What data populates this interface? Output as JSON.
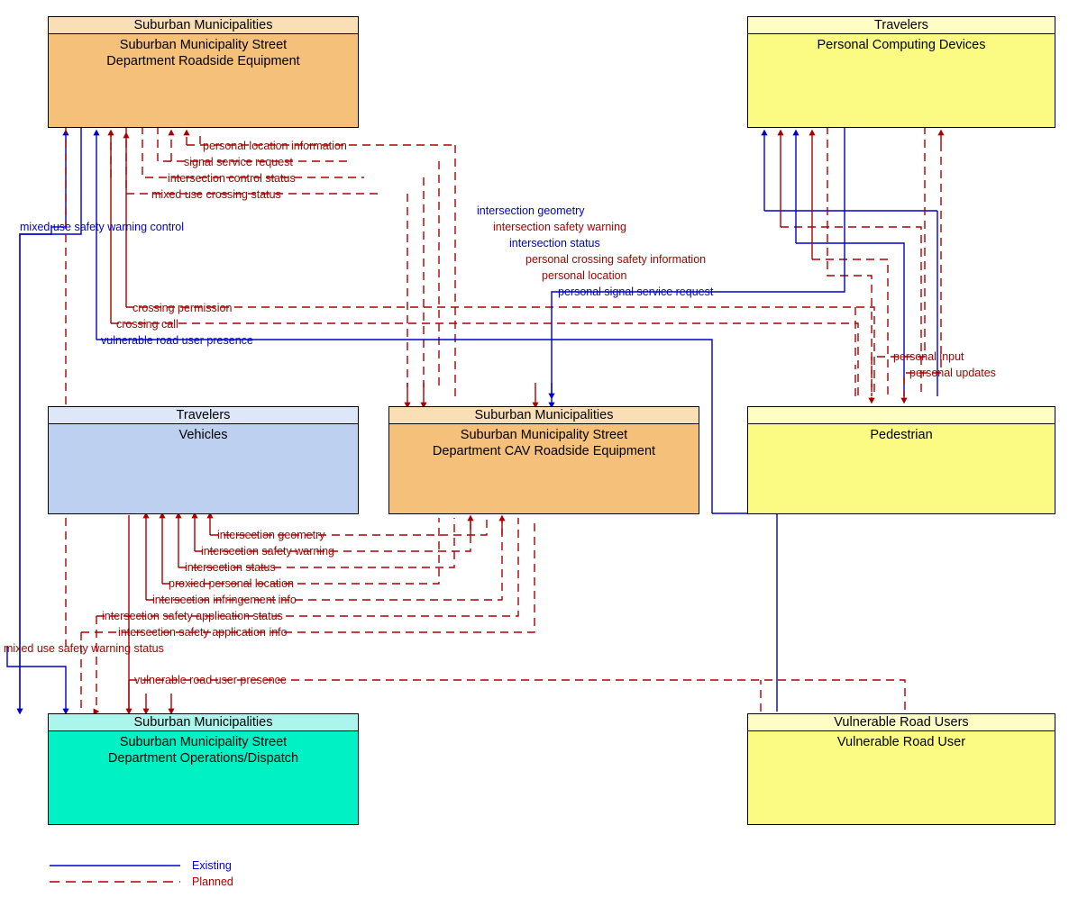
{
  "diagram": {
    "title": "Suburban Municipality Street Department Roadside Equipment Flow Diagram",
    "colors": {
      "existing": "#0000cc",
      "planned": "#aa0000",
      "node_orange": "#f5c07a",
      "node_yellow": "#fbfb84",
      "node_blue": "#bdd0ef",
      "node_green": "#00f2c4"
    }
  },
  "nodes": [
    {
      "id": "rse",
      "header": "Suburban Municipalities",
      "line1": "Suburban Municipality Street",
      "line2": "Department Roadside Equipment"
    },
    {
      "id": "pcd",
      "header": "Travelers",
      "line1": "Personal Computing Devices",
      "line2": ""
    },
    {
      "id": "vehicles",
      "header": "Travelers",
      "line1": "Vehicles",
      "line2": ""
    },
    {
      "id": "cav",
      "header": "Suburban Municipalities",
      "line1": "Suburban Municipality Street",
      "line2": "Department CAV Roadside Equipment"
    },
    {
      "id": "pedestrian",
      "header": "",
      "line1": "Pedestrian",
      "line2": ""
    },
    {
      "id": "dispatch",
      "header": "Suburban Municipalities",
      "line1": "Suburban Municipality Street",
      "line2": "Department Operations/Dispatch"
    },
    {
      "id": "vru",
      "header": "Vulnerable Road Users",
      "line1": "Vulnerable Road User",
      "line2": ""
    }
  ],
  "flows": [
    {
      "id": "f01",
      "label": "personal location information",
      "status": "planned"
    },
    {
      "id": "f02",
      "label": "signal service request",
      "status": "planned"
    },
    {
      "id": "f03",
      "label": "intersection control status",
      "status": "planned"
    },
    {
      "id": "f04",
      "label": "mixed use crossing status",
      "status": "planned"
    },
    {
      "id": "f05",
      "label": "mixed use safety warning control",
      "status": "existing"
    },
    {
      "id": "f06",
      "label": "intersection geometry",
      "status": "existing"
    },
    {
      "id": "f07",
      "label": "intersection safety warning",
      "status": "planned"
    },
    {
      "id": "f08",
      "label": "intersection status",
      "status": "existing"
    },
    {
      "id": "f09",
      "label": "personal crossing safety information",
      "status": "planned"
    },
    {
      "id": "f10",
      "label": "personal location",
      "status": "planned"
    },
    {
      "id": "f11",
      "label": "personal signal service request",
      "status": "existing"
    },
    {
      "id": "f12",
      "label": "crossing permission",
      "status": "planned"
    },
    {
      "id": "f13",
      "label": "crossing call",
      "status": "planned"
    },
    {
      "id": "f14",
      "label": "vulnerable road user presence",
      "status": "existing"
    },
    {
      "id": "f15",
      "label": "personal input",
      "status": "planned"
    },
    {
      "id": "f16",
      "label": "personal updates",
      "status": "planned"
    },
    {
      "id": "f17",
      "label": "intersection geometry",
      "status": "planned"
    },
    {
      "id": "f18",
      "label": "intersection safety warning",
      "status": "planned"
    },
    {
      "id": "f19",
      "label": "intersection status",
      "status": "planned"
    },
    {
      "id": "f20",
      "label": "proxied personal location",
      "status": "planned"
    },
    {
      "id": "f21",
      "label": "intersection infringement info",
      "status": "planned"
    },
    {
      "id": "f22",
      "label": "intersection safety application status",
      "status": "planned"
    },
    {
      "id": "f23",
      "label": "intersection safety application info",
      "status": "planned"
    },
    {
      "id": "f24",
      "label": "mixed use safety warning status",
      "status": "planned"
    },
    {
      "id": "f25",
      "label": "vulnerable road user presence",
      "status": "planned"
    }
  ],
  "legend": {
    "existing_label": "Existing",
    "planned_label": "Planned"
  }
}
